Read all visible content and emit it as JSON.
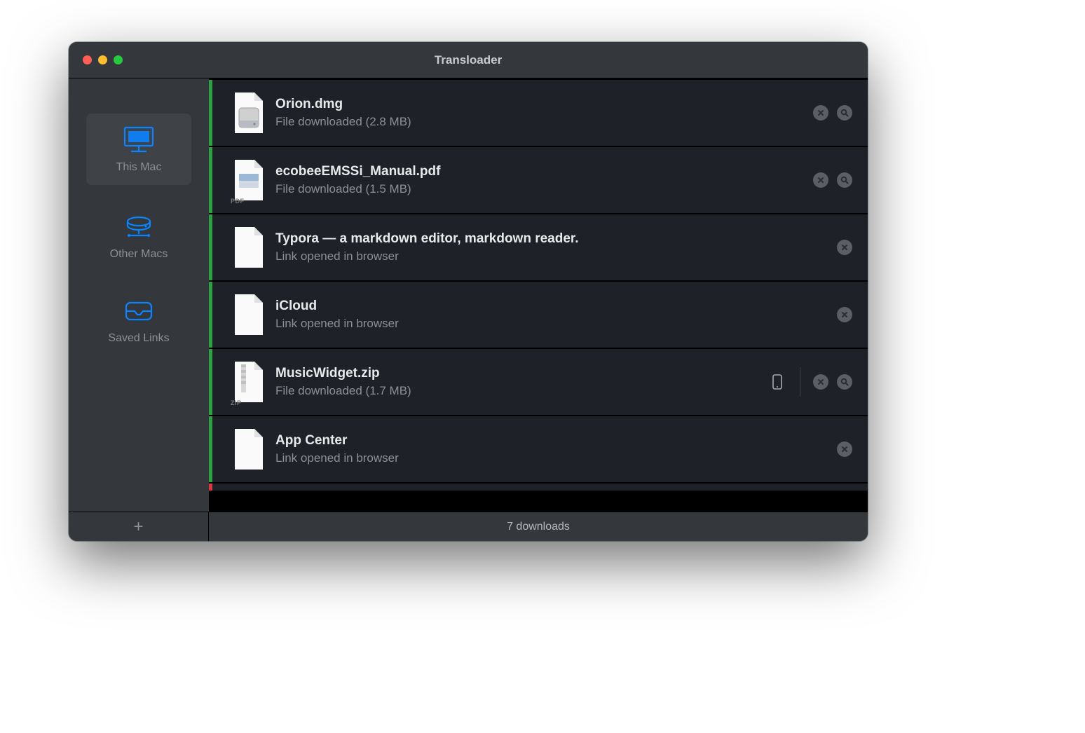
{
  "window": {
    "title": "Transloader"
  },
  "sidebar": {
    "items": [
      {
        "icon": "monitor-icon",
        "label": "This Mac",
        "selected": true
      },
      {
        "icon": "network-drive-icon",
        "label": "Other Macs",
        "selected": false
      },
      {
        "icon": "inbox-icon",
        "label": "Saved Links",
        "selected": false
      }
    ]
  },
  "downloads": [
    {
      "icon": "dmg-icon",
      "title": "Orion.dmg",
      "subtitle": "File downloaded (2.8 MB)",
      "accent": "green",
      "actions": [
        "remove",
        "reveal"
      ]
    },
    {
      "icon": "pdf-icon",
      "title": "ecobeeEMSSi_Manual.pdf",
      "subtitle": "File downloaded (1.5 MB)",
      "accent": "green",
      "actions": [
        "remove",
        "reveal"
      ]
    },
    {
      "icon": "blank-icon",
      "title": "Typora — a markdown editor, markdown reader.",
      "subtitle": "Link opened in browser",
      "accent": "green",
      "actions": [
        "remove"
      ]
    },
    {
      "icon": "blank-icon",
      "title": "iCloud",
      "subtitle": "Link opened in browser",
      "accent": "green",
      "actions": [
        "remove"
      ]
    },
    {
      "icon": "zip-icon",
      "title": "MusicWidget.zip",
      "subtitle": "File downloaded (1.7 MB)",
      "accent": "green",
      "device": true,
      "actions": [
        "remove",
        "reveal"
      ]
    },
    {
      "icon": "blank-icon",
      "title": "App Center",
      "subtitle": "Link opened in browser",
      "accent": "green",
      "actions": [
        "remove"
      ]
    }
  ],
  "partial": {
    "accent": "red"
  },
  "footer": {
    "add_label": "+",
    "status": "7 downloads"
  },
  "colors": {
    "accent": "#0a84ff",
    "green": "#2ea043",
    "red": "#d83b3b"
  }
}
